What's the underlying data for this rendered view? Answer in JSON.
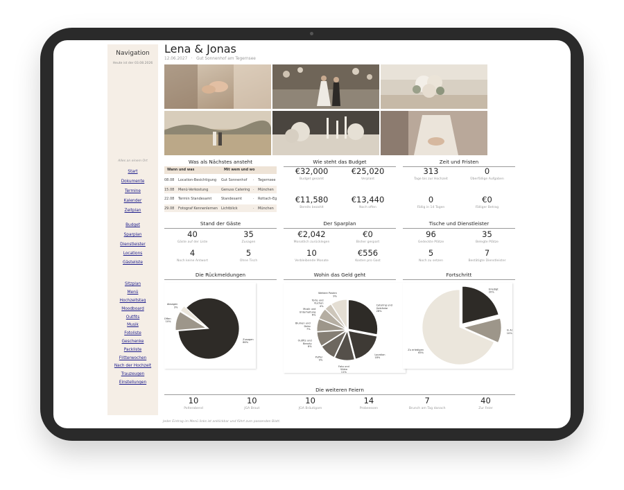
{
  "sidebar": {
    "title": "Navigation",
    "today": "Heute ist der 03.08.2026",
    "tagline": "Alles an einem Ort",
    "links": [
      "Start",
      "Dokumente",
      "Termine",
      "Kalender",
      "Zeitplan",
      "Budget",
      "Sparplan",
      "Dienstleister",
      "Locations",
      "Gästeliste",
      "Sitzplan",
      "Menü",
      "Hochzeitstag",
      "Moodboard",
      "Outfits",
      "Musik",
      "Fotoliste",
      "Geschenke",
      "Packliste",
      "Flitterwochen",
      "Nach der Hochzeit",
      "Trauzeugen",
      "Einstellungen"
    ]
  },
  "header": {
    "title": "Lena & Jonas",
    "date": "12.06.2027",
    "sep": "·",
    "venue": "Gut Sonnenhof am Tegernsee"
  },
  "next": {
    "title": "Was als Nächstes ansteht",
    "col1": "Wann und was",
    "col2": "Mit wem und wo",
    "rows": [
      {
        "date": "08.08",
        "what": "Location-Besichtigung",
        "who": "Gut Sonnenhof",
        "sep": "·",
        "where": "Tegernsee"
      },
      {
        "date": "15.08",
        "what": "Menü-Verkostung",
        "who": "Genuss Catering",
        "sep": "·",
        "where": "München"
      },
      {
        "date": "22.08",
        "what": "Termin Standesamt",
        "who": "Standesamt",
        "sep": "·",
        "where": "Rottach-Egern"
      },
      {
        "date": "29.08",
        "what": "Fotograf Kennenlernen",
        "who": "Lichtblick",
        "sep": "·",
        "where": "München"
      }
    ]
  },
  "budget": {
    "title": "Wie steht das Budget",
    "cells": [
      {
        "value": "€32,000",
        "label": "Budget gesamt"
      },
      {
        "value": "€25,020",
        "label": "Verplant"
      },
      {
        "value": "€11,580",
        "label": "Bereits bezahlt"
      },
      {
        "value": "€13,440",
        "label": "Noch offen"
      }
    ]
  },
  "time": {
    "title": "Zeit und Fristen",
    "cells": [
      {
        "value": "313",
        "label": "Tage bis zur Hochzeit"
      },
      {
        "value": "0",
        "label": "Überfällige Aufgaben"
      },
      {
        "value": "0",
        "label": "Fällig in 14 Tagen"
      },
      {
        "value": "€0",
        "label": "Fälliger Betrag"
      }
    ]
  },
  "guests": {
    "title": "Stand der Gäste",
    "cells": [
      {
        "value": "40",
        "label": "Gäste auf der Liste"
      },
      {
        "value": "35",
        "label": "Zusagen"
      },
      {
        "value": "4",
        "label": "Noch keine Antwort"
      },
      {
        "value": "5",
        "label": "Ohne Tisch"
      }
    ]
  },
  "savings": {
    "title": "Der Sparplan",
    "cells": [
      {
        "value": "€2,042",
        "label": "Monatlich zurücklegen"
      },
      {
        "value": "€0",
        "label": "Bisher gespart"
      },
      {
        "value": "10",
        "label": "Verbleibende Monate"
      },
      {
        "value": "€556",
        "label": "Kosten pro Gast"
      }
    ]
  },
  "tables": {
    "title": "Tische und Dienstleister",
    "cells": [
      {
        "value": "96",
        "label": "Gedeckte Plätze"
      },
      {
        "value": "35",
        "label": "Belegte Plätze"
      },
      {
        "value": "5",
        "label": "Noch zu setzen"
      },
      {
        "value": "7",
        "label": "Bestätigte Dienstleister"
      }
    ]
  },
  "charts_titles": {
    "rsvp": "Die Rückmeldungen",
    "money": "Wohin das Geld geht",
    "progress": "Fortschritt"
  },
  "chart_data": [
    {
      "type": "pie",
      "title": "Die Rückmeldungen",
      "slices": [
        {
          "label": "Zusagen",
          "value": 86,
          "text": "86%"
        },
        {
          "label": "Offen",
          "value": 10,
          "text": "10%"
        },
        {
          "label": "Absagen",
          "value": 3,
          "text": "3%"
        }
      ],
      "colors": [
        "#2e2b27",
        "#9d968a",
        "#ebe6dc"
      ]
    },
    {
      "type": "pie",
      "title": "Wohin das Geld geht",
      "slices": [
        {
          "label": "Catering und Getränke",
          "value": 28,
          "text": "28%"
        },
        {
          "label": "Location",
          "value": 18,
          "text": "18%"
        },
        {
          "label": "Foto und Video",
          "value": 11,
          "text": "11%"
        },
        {
          "label": "Puffer",
          "value": 9,
          "text": "9%"
        },
        {
          "label": "Outfits und Beauty",
          "value": 8,
          "text": "8%"
        },
        {
          "label": "Blumen und Deko",
          "value": 7,
          "text": "7%"
        },
        {
          "label": "Musik und Unterhaltung",
          "value": 6,
          "text": "6%"
        },
        {
          "label": "Torte und Kuchen",
          "value": 4,
          "text": "4%"
        },
        {
          "label": "Weitere Posten",
          "value": 9,
          "text": "9%"
        }
      ],
      "colors": [
        "#2e2b27",
        "#3e3a35",
        "#55504a",
        "#6d675f",
        "#857e74",
        "#9d968a",
        "#b5aea2",
        "#cdc6ba",
        "#e4ded3"
      ]
    },
    {
      "type": "pie",
      "title": "Fortschritt",
      "slices": [
        {
          "label": "Erledigt",
          "value": 20,
          "text": "20%"
        },
        {
          "label": "In Arbeit",
          "value": 10,
          "text": "10%"
        },
        {
          "label": "Zu erledigen",
          "value": 65,
          "text": "65%"
        }
      ],
      "colors": [
        "#2e2b27",
        "#9d968a",
        "#ebe6dc"
      ]
    }
  ],
  "celebrations": {
    "title": "Die weiteren Feiern",
    "cells": [
      {
        "value": "10",
        "label": "Polterabend"
      },
      {
        "value": "10",
        "label": "JGA Braut"
      },
      {
        "value": "10",
        "label": "JGA Bräutigam"
      },
      {
        "value": "14",
        "label": "Probeessen"
      },
      {
        "value": "7",
        "label": "Brunch am Tag danach"
      },
      {
        "value": "40",
        "label": "Zur Feier"
      }
    ]
  },
  "footer": "Jeder Eintrag im Menü links ist anklickbar und führt zum passenden Blatt."
}
